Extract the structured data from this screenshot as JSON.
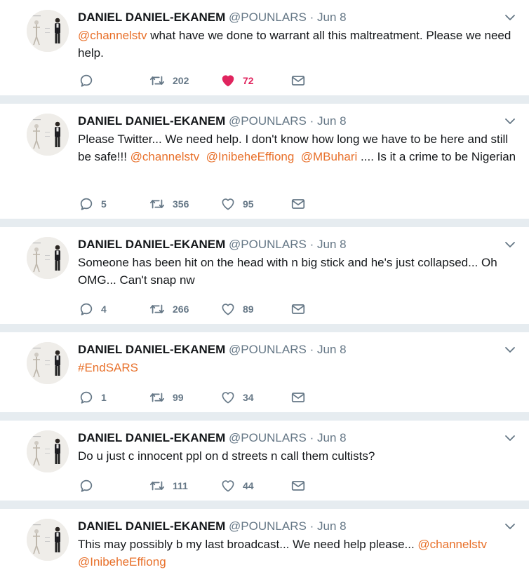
{
  "tweets": [
    {
      "name": "DANIEL DANIEL-EKANEM",
      "handle": "@POUNLARS",
      "sep": "·",
      "date": "Jun 8",
      "segments": [
        {
          "text": "@channelstv",
          "link": true
        },
        {
          "text": " what have we done to warrant all this maltreatment. Please we need help.",
          "link": false
        }
      ],
      "reply_count": "",
      "retweet_count": "202",
      "like_count": "72",
      "liked": true
    },
    {
      "name": "DANIEL DANIEL-EKANEM",
      "handle": "@POUNLARS",
      "sep": "·",
      "date": "Jun 8",
      "segments": [
        {
          "text": "Please Twitter... We need help. I don't know how long we have to be here and still be safe!!! ",
          "link": false
        },
        {
          "text": "@channelstv",
          "link": true
        },
        {
          "text": "  ",
          "link": false
        },
        {
          "text": "@InibeheEffiong",
          "link": true
        },
        {
          "text": "  ",
          "link": false
        },
        {
          "text": "@MBuhari",
          "link": true
        },
        {
          "text": " .... Is it a crime to be Nigerian",
          "link": false
        }
      ],
      "reply_count": "5",
      "retweet_count": "356",
      "like_count": "95",
      "liked": false
    },
    {
      "name": "DANIEL DANIEL-EKANEM",
      "handle": "@POUNLARS",
      "sep": "·",
      "date": "Jun 8",
      "segments": [
        {
          "text": "Someone has been hit on the head with n big stick and he's just collapsed... Oh OMG... Can't snap nw",
          "link": false
        }
      ],
      "reply_count": "4",
      "retweet_count": "266",
      "like_count": "89",
      "liked": false
    },
    {
      "name": "DANIEL DANIEL-EKANEM",
      "handle": "@POUNLARS",
      "sep": "·",
      "date": "Jun 8",
      "segments": [
        {
          "text": "#EndSARS",
          "link": true
        }
      ],
      "reply_count": "1",
      "retweet_count": "99",
      "like_count": "34",
      "liked": false
    },
    {
      "name": "DANIEL DANIEL-EKANEM",
      "handle": "@POUNLARS",
      "sep": "·",
      "date": "Jun 8",
      "segments": [
        {
          "text": "Do u just c innocent ppl on d streets n call them cultists?",
          "link": false
        }
      ],
      "reply_count": "",
      "retweet_count": "111",
      "like_count": "44",
      "liked": false
    },
    {
      "name": "DANIEL DANIEL-EKANEM",
      "handle": "@POUNLARS",
      "sep": "·",
      "date": "Jun 8",
      "segments": [
        {
          "text": "This may possibly b my last broadcast... We need help please... ",
          "link": false
        },
        {
          "text": "@channelstv",
          "link": true
        },
        {
          "text": " ",
          "link": false
        },
        {
          "text": "@InibeheEffiong",
          "link": true
        }
      ],
      "reply_count": "",
      "retweet_count": "",
      "like_count": "",
      "liked": false,
      "actions_visible": false
    }
  ],
  "icons": {
    "reply": "reply-icon",
    "retweet": "retweet-icon",
    "like": "heart-icon",
    "dm": "envelope-icon",
    "menu": "chevron-down-icon"
  },
  "colors": {
    "link": "#e8702a",
    "muted": "#657786",
    "like_active": "#e0245e",
    "separator": "#e6ecf0"
  }
}
